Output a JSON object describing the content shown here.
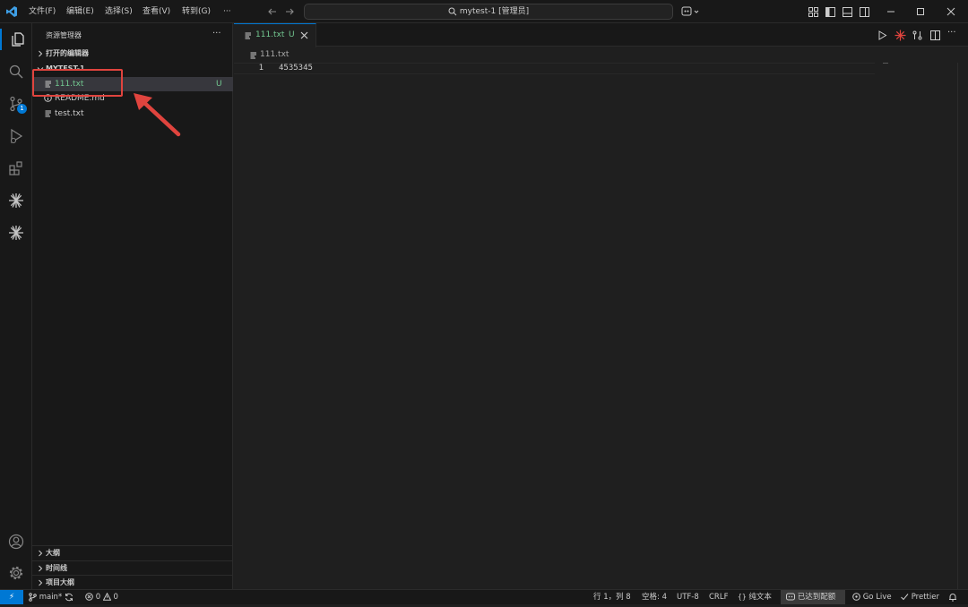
{
  "app": {
    "logo": "vscode-logo",
    "accent": "#0078d4"
  },
  "menubar": {
    "items": [
      "文件(F)",
      "编辑(E)",
      "选择(S)",
      "查看(V)",
      "转到(G)",
      "···"
    ]
  },
  "command_center": {
    "text": "mytest-1 [管理员]",
    "icon": "search-icon"
  },
  "sidebar": {
    "title": "资源管理器",
    "more": "···",
    "open_editors": "打开的编辑器",
    "folder": "MYTEST-1",
    "files": [
      {
        "name": "111.txt",
        "icon": "text-file-icon",
        "badge": "U",
        "selected": true
      },
      {
        "name": "README.md",
        "icon": "info-icon",
        "badge": ""
      },
      {
        "name": "test.txt",
        "icon": "text-file-icon",
        "badge": ""
      }
    ],
    "bottom_sections": [
      "大纲",
      "时间线",
      "项目大纲"
    ]
  },
  "activity": {
    "source_control_badge": "1"
  },
  "editor": {
    "tab_label": "111.txt",
    "tab_badge": "U",
    "breadcrumb": "111.txt",
    "lines": [
      {
        "number": "1",
        "text": "4535345"
      }
    ]
  },
  "statusbar": {
    "remote": "⚡",
    "branch": "main*",
    "errors": "0",
    "warnings": "0",
    "position": "行 1，列 8",
    "spaces": "空格: 4",
    "encoding": "UTF-8",
    "eol": "CRLF",
    "language": "纯文本",
    "quota": "已达到配额",
    "golive": "Go Live",
    "prettier": "Prettier"
  },
  "colors": {
    "modified": "#73c991",
    "annotation": "#e0443e"
  }
}
